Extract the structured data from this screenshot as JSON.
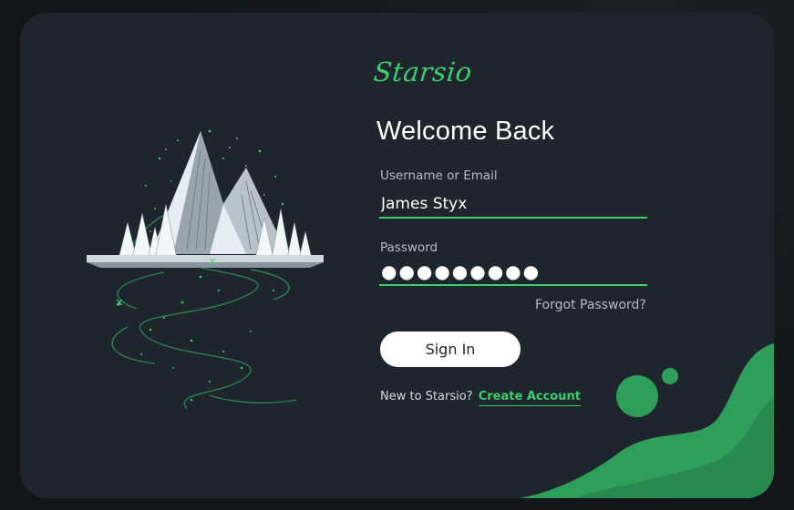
{
  "brand": {
    "name": "Starsio"
  },
  "login": {
    "title": "Welcome Back",
    "username_label": "Username or Email",
    "username_value": "James Styx",
    "password_label": "Password",
    "password_value": "●●●●●●●●●",
    "forgot_label": "Forgot Password?",
    "signin_label": "Sign In",
    "new_prefix": "New to Starsio?",
    "create_label": "Create Account"
  },
  "colors": {
    "card_bg": "#1e252d",
    "accent_green": "#3ccf6e",
    "blob_green": "#2f9e5a",
    "button_bg": "#ffffff"
  },
  "icons": {
    "illustration": "mountain-river-night-illustration",
    "decoration": "green-blob-shapes"
  }
}
